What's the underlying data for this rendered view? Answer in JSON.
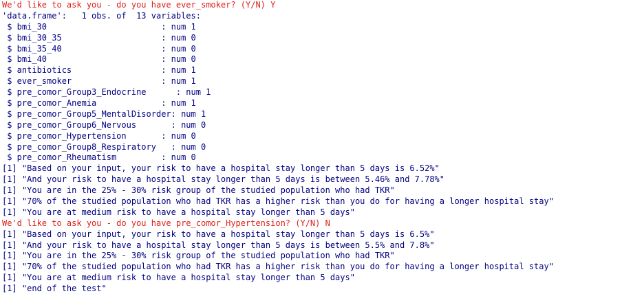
{
  "colors": {
    "prompt": "#e0201a",
    "output": "#000080",
    "background": "#ffffff"
  },
  "console": {
    "lines": [
      {
        "kind": "prompt",
        "text": "We'd like to ask you - do you have ever_smoker? (Y/N) Y"
      },
      {
        "kind": "out",
        "text": "'data.frame':   1 obs. of  13 variables:"
      },
      {
        "kind": "out",
        "text": " $ bmi_30                       : num 1"
      },
      {
        "kind": "out",
        "text": " $ bmi_30_35                    : num 0"
      },
      {
        "kind": "out",
        "text": " $ bmi_35_40                    : num 0"
      },
      {
        "kind": "out",
        "text": " $ bmi_40                       : num 0"
      },
      {
        "kind": "out",
        "text": " $ antibiotics                  : num 1"
      },
      {
        "kind": "out",
        "text": " $ ever_smoker                  : num 1"
      },
      {
        "kind": "out",
        "text": " $ pre_comor_Group3_Endocrine      : num 1"
      },
      {
        "kind": "out",
        "text": " $ pre_comor_Anemia             : num 1"
      },
      {
        "kind": "out",
        "text": " $ pre_comor_Group5_MentalDisorder: num 1"
      },
      {
        "kind": "out",
        "text": " $ pre_comor_Group6_Nervous       : num 0"
      },
      {
        "kind": "out",
        "text": " $ pre_comor_Hypertension       : num 0"
      },
      {
        "kind": "out",
        "text": " $ pre_comor_Group8_Respiratory   : num 0"
      },
      {
        "kind": "out",
        "text": " $ pre_comor_Rheumatism         : num 0"
      },
      {
        "kind": "out",
        "text": "[1] \"Based on your input, your risk to have a hospital stay longer than 5 days is 6.52%\""
      },
      {
        "kind": "out",
        "text": "[1] \"And your risk to have a hospital stay longer than 5 days is between 5.46% and 7.78%\""
      },
      {
        "kind": "out",
        "text": "[1] \"You are in the 25% - 30% risk group of the studied population who had TKR\""
      },
      {
        "kind": "out",
        "text": "[1] \"70% of the studied population who had TKR has a higher risk than you do for having a longer hospital stay\""
      },
      {
        "kind": "out",
        "text": "[1] \"You are at medium risk to have a hospital stay longer than 5 days\""
      },
      {
        "kind": "prompt",
        "text": "We'd like to ask you - do you have pre_comor_Hypertension? (Y/N) N"
      },
      {
        "kind": "out",
        "text": "[1] \"Based on your input, your risk to have a hospital stay longer than 5 days is 6.5%\""
      },
      {
        "kind": "out",
        "text": "[1] \"And your risk to have a hospital stay longer than 5 days is between 5.5% and 7.8%\""
      },
      {
        "kind": "out",
        "text": "[1] \"You are in the 25% - 30% risk group of the studied population who had TKR\""
      },
      {
        "kind": "out",
        "text": "[1] \"70% of the studied population who had TKR has a higher risk than you do for having a longer hospital stay\""
      },
      {
        "kind": "out",
        "text": "[1] \"You are at medium risk to have a hospital stay longer than 5 days\""
      },
      {
        "kind": "out",
        "text": "[1] \"end of the test\""
      }
    ]
  }
}
